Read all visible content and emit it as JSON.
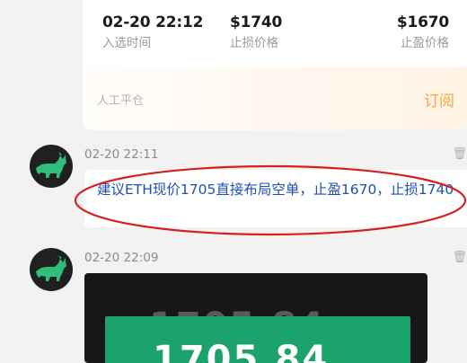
{
  "signal_card": {
    "entry": {
      "value": "02-20 22:12",
      "label": "入选时间"
    },
    "stop_loss": {
      "value": "$1740",
      "label": "止损价格"
    },
    "take_profit": {
      "value": "$1670",
      "label": "止盈价格"
    },
    "status": "人工平仓",
    "subscribe_label": "订阅"
  },
  "messages": [
    {
      "time": "02-20 22:11",
      "side_icon": "🗑",
      "text": "建议ETH现价1705直接布局空单，止盈1670，止损1740"
    },
    {
      "time": "02-20 22:09",
      "side_icon": "🗑",
      "image_price_top": "1705.84",
      "image_price": "1705.84"
    }
  ],
  "colors": {
    "accent_orange": "#f3a83c",
    "message_blue": "#1f50b8",
    "annotation_red": "#d81f1f",
    "price_green": "#1ca26d"
  },
  "icons": {
    "avatar": "bull-icon",
    "side_action": "trash-icon"
  }
}
